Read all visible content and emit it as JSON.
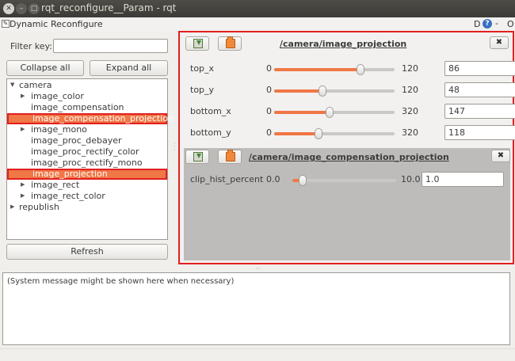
{
  "window": {
    "title": "rqt_reconfigure__Param - rqt",
    "buttons": {
      "close": "✕",
      "minimize": "–",
      "maximize": "□"
    }
  },
  "plugin": {
    "title": "Dynamic Reconfigure",
    "right_d": "D",
    "right_help": "?",
    "right_dash": "-",
    "right_o": "O"
  },
  "filter": {
    "label": "Filter key:",
    "value": ""
  },
  "buttons": {
    "collapse": "Collapse all",
    "expand": "Expand all",
    "refresh": "Refresh"
  },
  "tree": {
    "items": [
      {
        "label": "camera",
        "arrow": "▼",
        "selected": false
      },
      {
        "label": "image_color",
        "arrow": "▶",
        "selected": false
      },
      {
        "label": "image_compensation",
        "arrow": "",
        "selected": false
      },
      {
        "label": "image_compensation_projection",
        "arrow": "",
        "selected": true
      },
      {
        "label": "image_mono",
        "arrow": "▶",
        "selected": false
      },
      {
        "label": "image_proc_debayer",
        "arrow": "",
        "selected": false
      },
      {
        "label": "image_proc_rectify_color",
        "arrow": "",
        "selected": false
      },
      {
        "label": "image_proc_rectify_mono",
        "arrow": "",
        "selected": false
      },
      {
        "label": "image_projection",
        "arrow": "",
        "selected": true
      },
      {
        "label": "image_rect",
        "arrow": "▶",
        "selected": false
      },
      {
        "label": "image_rect_color",
        "arrow": "▶",
        "selected": false
      },
      {
        "label": "republish",
        "arrow": "▶",
        "selected": false
      }
    ]
  },
  "groups": [
    {
      "title": "/camera/image_projection",
      "close": "✖",
      "params": [
        {
          "name": "top_x",
          "min": "0",
          "max": "120",
          "value": "86",
          "fraction": 0.717
        },
        {
          "name": "top_y",
          "min": "0",
          "max": "120",
          "value": "48",
          "fraction": 0.4
        },
        {
          "name": "bottom_x",
          "min": "0",
          "max": "320",
          "value": "147",
          "fraction": 0.459
        },
        {
          "name": "bottom_y",
          "min": "0",
          "max": "320",
          "value": "118",
          "fraction": 0.369
        }
      ]
    },
    {
      "title": "/camera/image_compensation_projection",
      "close": "✖",
      "params": [
        {
          "name": "clip_hist_percent",
          "min": "0.0",
          "max": "10.0",
          "value": "1.0",
          "fraction": 0.1
        }
      ]
    }
  ],
  "syslog": {
    "text": "(System message might be shown here when necessary)"
  },
  "colors": {
    "accent": "#f07746",
    "highlight_border": "#e21f1f",
    "titlebar": "#3c3b37"
  }
}
